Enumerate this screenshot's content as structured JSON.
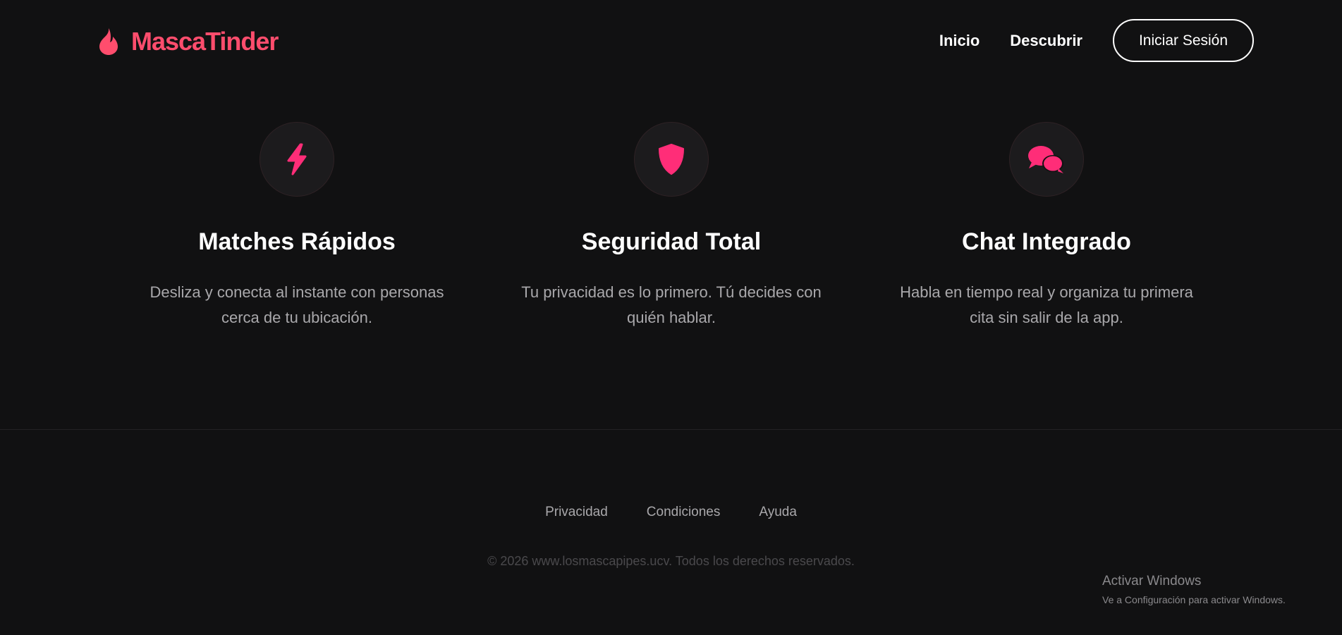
{
  "brand": {
    "name": "MascaTinder",
    "icon": "flame-icon",
    "color": "#ff4d6d"
  },
  "nav": {
    "links": [
      "Inicio",
      "Descubrir"
    ],
    "login_label": "Iniciar Sesión"
  },
  "features": [
    {
      "icon": "lightning-bolt-icon",
      "title": "Matches Rápidos",
      "description": "Desliza y conecta al instante con personas cerca de tu ubicación."
    },
    {
      "icon": "shield-icon",
      "title": "Seguridad Total",
      "description": "Tu privacidad es lo primero. Tú decides con quién hablar."
    },
    {
      "icon": "chat-bubbles-icon",
      "title": "Chat Integrado",
      "description": "Habla en tiempo real y organiza tu primera cita sin salir de la app."
    }
  ],
  "footer": {
    "links": [
      "Privacidad",
      "Condiciones",
      "Ayuda"
    ],
    "copyright": "© 2026 www.losmascapipes.ucv. Todos los derechos reservados."
  },
  "watermark": {
    "title": "Activar Windows",
    "subtitle": "Ve a Configuración para activar Windows."
  },
  "colors": {
    "accent": "#ff2d78",
    "background": "#111112"
  }
}
